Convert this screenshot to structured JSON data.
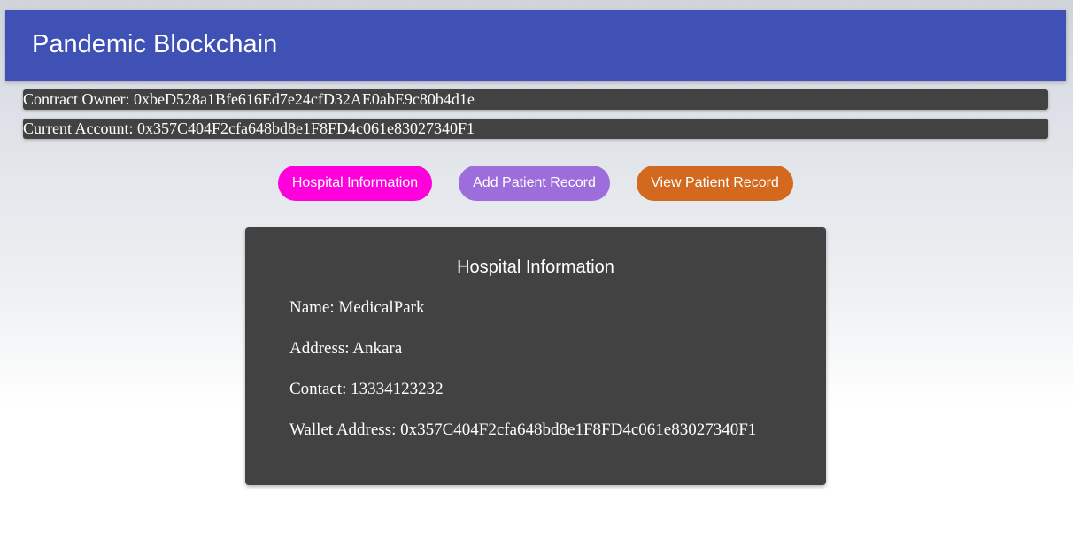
{
  "header": {
    "title": "Pandemic Blockchain"
  },
  "contract_owner": {
    "text": "Contract Owner: 0xbeD528a1Bfe616Ed7e24cfD32AE0abE9c80b4d1e"
  },
  "current_account": {
    "text": "Current Account: 0x357C404F2cfa648bd8e1F8FD4c061e83027340F1"
  },
  "nav": {
    "hospital_info": "Hospital Information",
    "add_patient": "Add Patient Record",
    "view_patient": "View Patient Record"
  },
  "colors": {
    "appbar": "#3f51b5",
    "hospital_info_button": "#ff00dd",
    "add_patient_button": "#9c6ddb",
    "view_patient_button": "#d2691e",
    "card": "#424242"
  },
  "hospital_card": {
    "title": "Hospital Information",
    "name": "Name: MedicalPark",
    "address": "Address: Ankara",
    "contact": "Contact: 13334123232",
    "wallet": "Wallet Address: 0x357C404F2cfa648bd8e1F8FD4c061e83027340F1"
  }
}
